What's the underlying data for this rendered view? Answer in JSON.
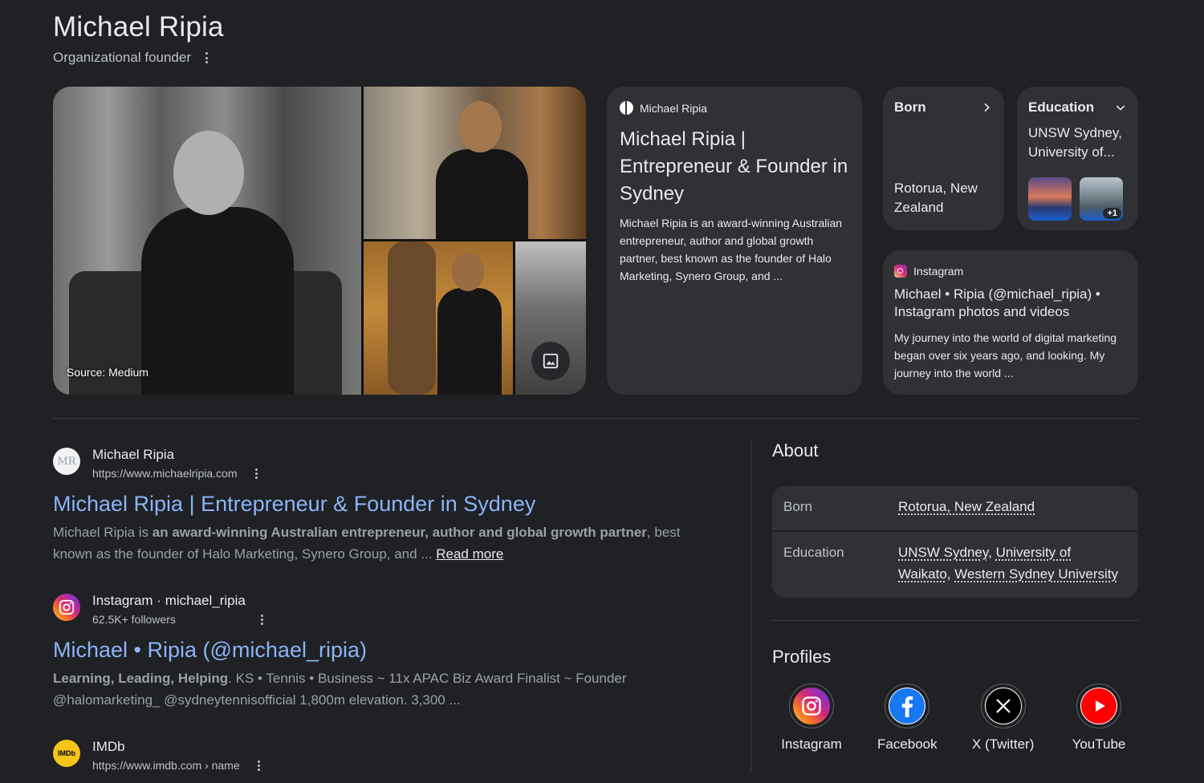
{
  "header": {
    "title": "Michael Ripia",
    "subtitle": "Organizational founder"
  },
  "collage": {
    "source_label": "Source: Medium"
  },
  "source_card": {
    "site": "Michael Ripia",
    "title": "Michael Ripia | Entrepreneur & Founder in Sydney",
    "snippet": "Michael Ripia is an award-winning Australian entrepreneur, author and global growth partner, best known as the founder of Halo Marketing, Synero Group, and ..."
  },
  "born_card": {
    "label": "Born",
    "value": "Rotorua, New Zealand"
  },
  "education_card": {
    "label": "Education",
    "value": "UNSW Sydney, University of...",
    "more_badge": "+1"
  },
  "instagram_card": {
    "site": "Instagram",
    "title": "Michael • Ripia (@michael_ripia) • Instagram photos and videos",
    "snippet": "My journey into the world of digital marketing began over six years ago, and looking. My journey into the world ..."
  },
  "results": [
    {
      "favicon_text": "MR",
      "site_name": "Michael Ripia",
      "url": "https://www.michaelripia.com",
      "title": "Michael Ripia | Entrepreneur & Founder in Sydney",
      "snippet_pre": "Michael Ripia is ",
      "snippet_bold": "an award-winning Australian entrepreneur, author and global growth partner",
      "snippet_post": ", best known as the founder of Halo Marketing, Synero Group, and ... ",
      "read_more": "Read more"
    },
    {
      "site_name": "Instagram · michael_ripia",
      "url": "62.5K+ followers",
      "title": "Michael • Ripia (@michael_ripia)",
      "snippet_bold": "Learning, Leading, Helping",
      "snippet_post": ". KS • Tennis • Business ~ 11x APAC Biz Award Finalist ~ Founder @halomarketing_ @sydneytennisofficial 1,800m elevation. 3,300 ..."
    },
    {
      "favicon_text": "IMDb",
      "site_name": "IMDb",
      "url": "https://www.imdb.com › name"
    }
  ],
  "about": {
    "title": "About",
    "rows": [
      {
        "label": "Born",
        "value": "Rotorua, New Zealand"
      },
      {
        "label": "Education",
        "values": [
          "UNSW Sydney",
          "University of Waikato",
          "Western Sydney University"
        ]
      }
    ]
  },
  "profiles": {
    "title": "Profiles",
    "items": [
      {
        "label": "Instagram",
        "icon": "instagram-icon"
      },
      {
        "label": "Facebook",
        "icon": "facebook-icon"
      },
      {
        "label": "X (Twitter)",
        "icon": "x-icon"
      },
      {
        "label": "YouTube",
        "icon": "youtube-icon"
      }
    ]
  }
}
